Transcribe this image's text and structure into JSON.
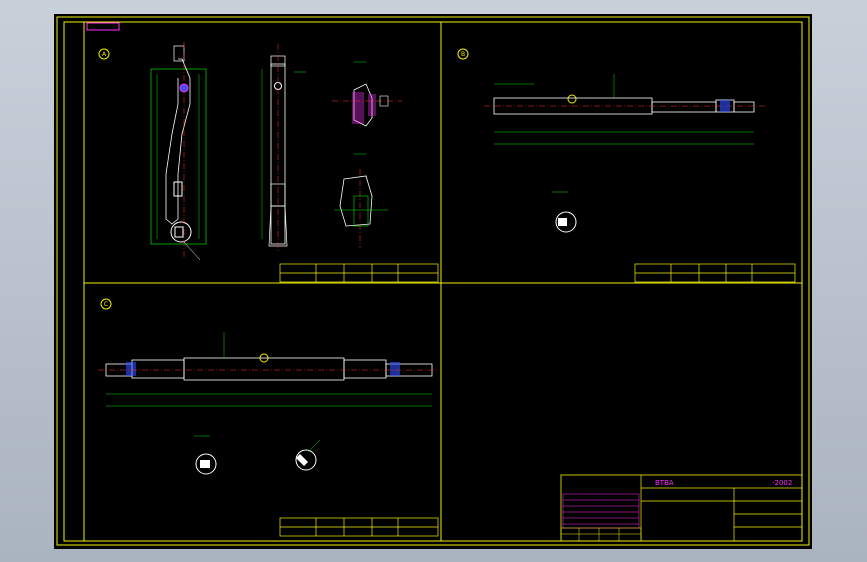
{
  "drawing": {
    "sheet_tag": "",
    "view_markers": {
      "a": "A",
      "b": "B",
      "c": "C"
    },
    "title_block": {
      "header": "BTBA",
      "project_title": "",
      "year": "-2002",
      "sheet_name": "",
      "drawing_number": ""
    },
    "colors": {
      "frame": "#f2f200",
      "geometry": "#ffffff",
      "dimension": "#00e000",
      "annotation": "#ff30ff",
      "centerline": "#ff3030",
      "hidden": "#3050ff"
    }
  }
}
